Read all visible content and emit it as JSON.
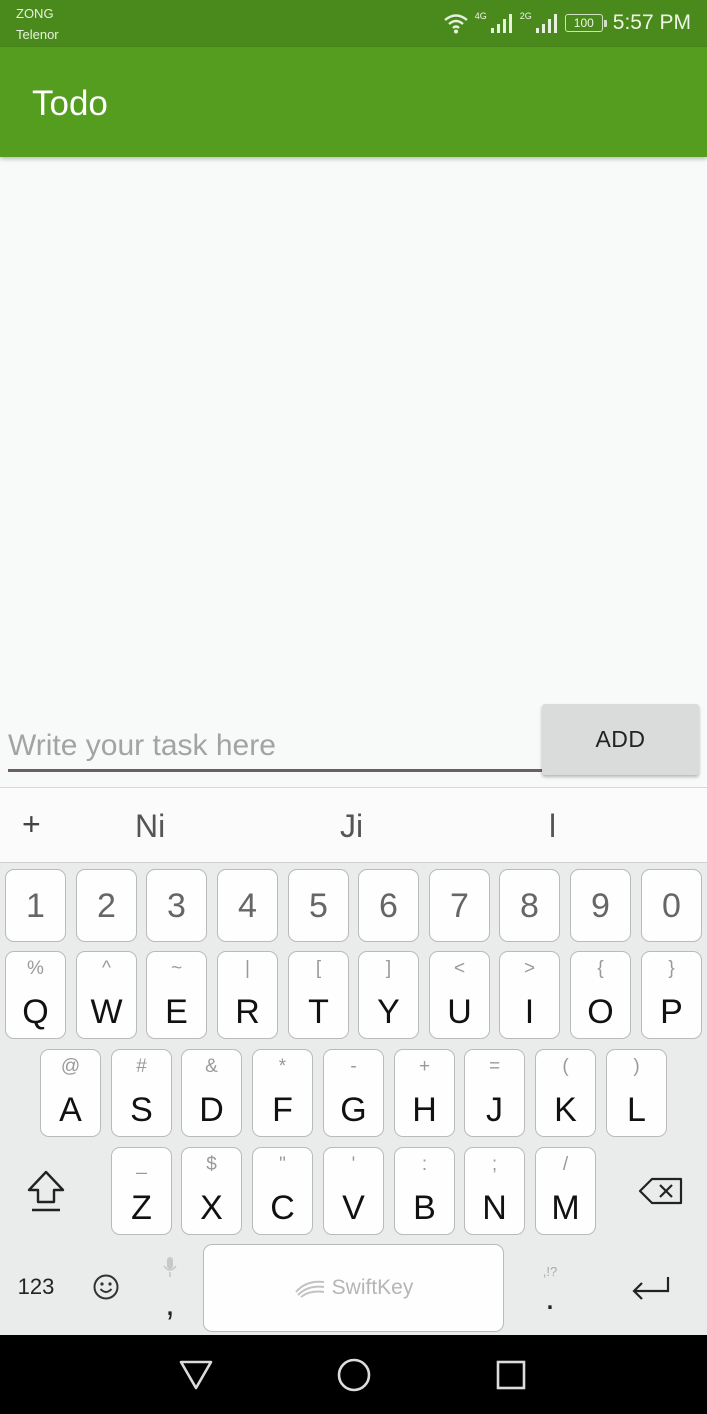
{
  "status_bar": {
    "carrier_1": "ZONG",
    "carrier_2": "Telenor",
    "network_1": "4G",
    "network_2": "2G",
    "battery": "100",
    "time": "5:57 PM",
    "icons": [
      "wifi-icon",
      "signal-icon",
      "signal-icon",
      "battery-icon"
    ]
  },
  "app_bar": {
    "title": "Todo",
    "color": "#559d1e"
  },
  "task_form": {
    "input_value": "",
    "input_placeholder": "Write your task here",
    "add_label": "ADD"
  },
  "keyboard": {
    "suggestions": {
      "plus": "+",
      "items": [
        "Ni",
        "Ji",
        "l"
      ]
    },
    "number_row": [
      "1",
      "2",
      "3",
      "4",
      "5",
      "6",
      "7",
      "8",
      "9",
      "0"
    ],
    "row_1": [
      {
        "key": "Q",
        "hint": "%"
      },
      {
        "key": "W",
        "hint": "^"
      },
      {
        "key": "E",
        "hint": "~"
      },
      {
        "key": "R",
        "hint": "|"
      },
      {
        "key": "T",
        "hint": "["
      },
      {
        "key": "Y",
        "hint": "]"
      },
      {
        "key": "U",
        "hint": "<"
      },
      {
        "key": "I",
        "hint": ">"
      },
      {
        "key": "O",
        "hint": "{"
      },
      {
        "key": "P",
        "hint": "}"
      }
    ],
    "row_2": [
      {
        "key": "A",
        "hint": "@"
      },
      {
        "key": "S",
        "hint": "#"
      },
      {
        "key": "D",
        "hint": "&"
      },
      {
        "key": "F",
        "hint": "*"
      },
      {
        "key": "G",
        "hint": "-"
      },
      {
        "key": "H",
        "hint": "+"
      },
      {
        "key": "J",
        "hint": "="
      },
      {
        "key": "K",
        "hint": "("
      },
      {
        "key": "L",
        "hint": ")"
      }
    ],
    "row_3": [
      {
        "key": "Z",
        "hint": "_"
      },
      {
        "key": "X",
        "hint": "$"
      },
      {
        "key": "C",
        "hint": "\""
      },
      {
        "key": "V",
        "hint": "'"
      },
      {
        "key": "B",
        "hint": ":"
      },
      {
        "key": "N",
        "hint": ";"
      },
      {
        "key": "M",
        "hint": "/"
      }
    ],
    "bottom": {
      "numbers_label": "123",
      "comma": ",",
      "space_label": "SwiftKey",
      "period": ".",
      "period_hint": ",!?"
    }
  },
  "nav_bar": {
    "icons": [
      "back-icon",
      "home-icon",
      "recents-icon"
    ]
  }
}
